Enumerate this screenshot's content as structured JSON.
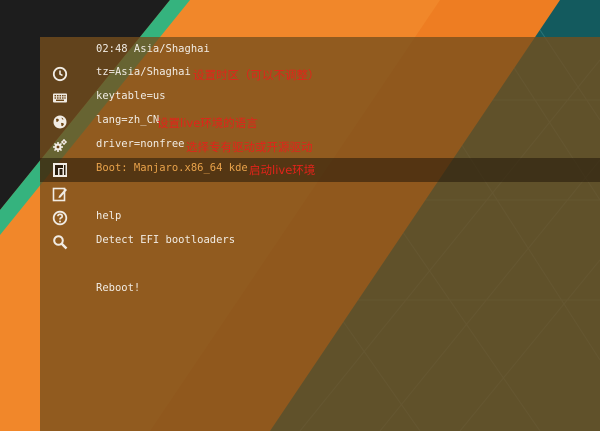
{
  "colors": {
    "panel": "#6b4515",
    "text": "#f1ece4",
    "selected_text": "#e8a24a",
    "annotation": "#e2231a",
    "accent_green": "#35b37e",
    "accent_orange": "#ee7d22"
  },
  "menu": {
    "time": "02:48 Asia/Shaghai",
    "items": [
      {
        "label": "tz=Asia/Shaghai",
        "icon": "clock-icon"
      },
      {
        "label": "keytable=us",
        "icon": "keyboard-icon"
      },
      {
        "label": "lang=zh_CN",
        "icon": "globe-icon"
      },
      {
        "label": "driver=nonfree",
        "icon": "gears-icon"
      },
      {
        "label": "Boot: Manjaro.x86_64 kde",
        "icon": "boot-icon",
        "selected": true
      },
      {
        "label": "",
        "icon": "edit-icon"
      },
      {
        "label": "help",
        "icon": "help-icon"
      },
      {
        "label": "Detect EFI bootloaders",
        "icon": "search-icon"
      },
      {
        "label": "Reboot!",
        "icon": ""
      }
    ]
  },
  "annotations": {
    "tz": "设置时区（可以不调整）",
    "lang": "设置live环境的语言",
    "driver": "选择专有驱动或开源驱动",
    "boot": "启动live环境"
  }
}
